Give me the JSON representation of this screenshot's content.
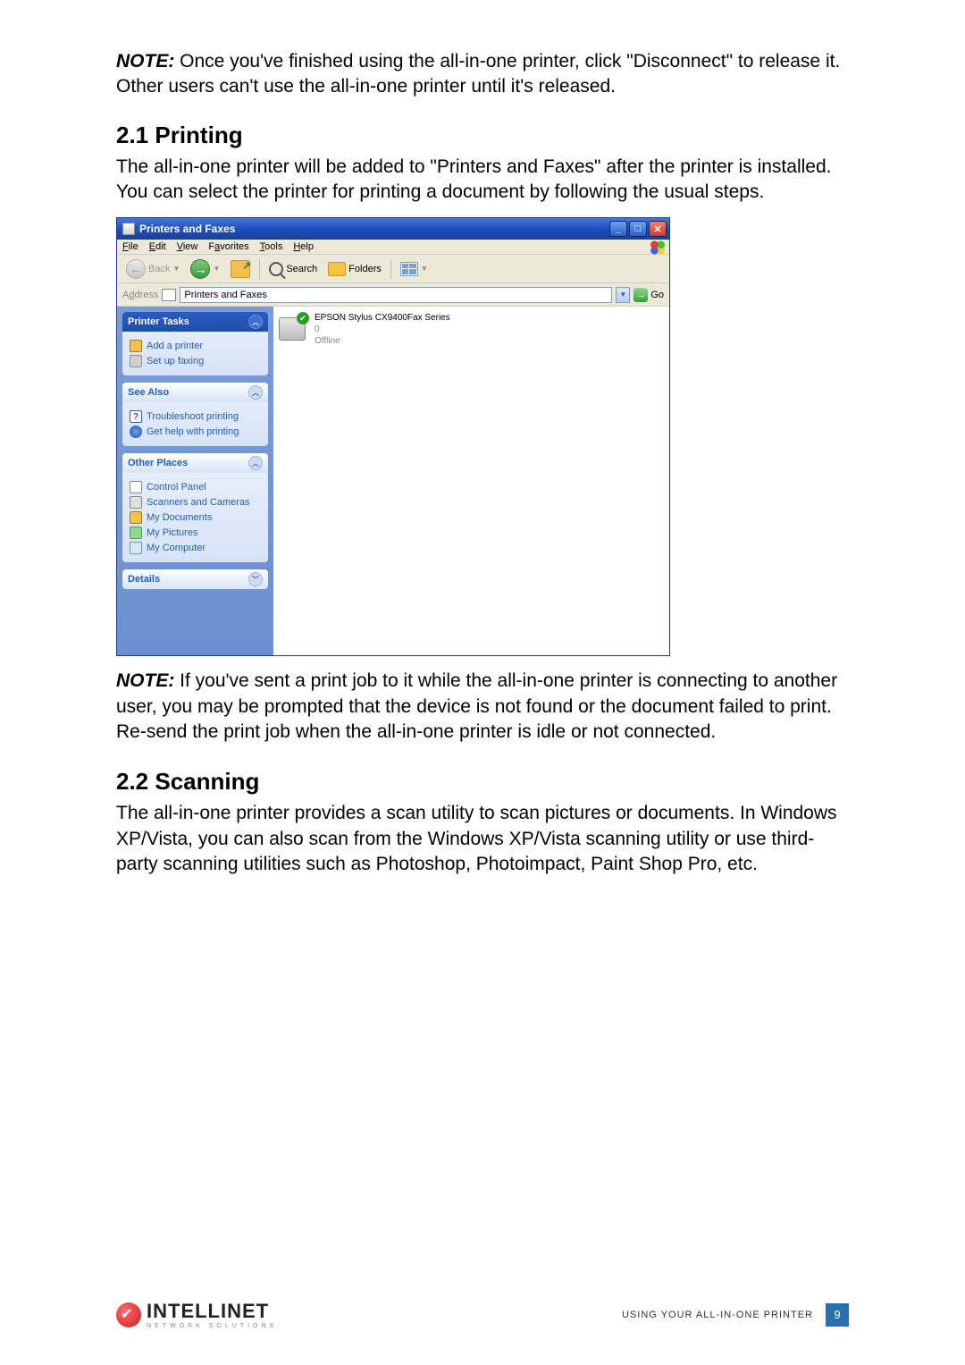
{
  "intro": {
    "note_prefix": "NOTE:",
    "text": " Once you've finished using the all-in-one printer, click \"Disconnect\" to release it. Other users can't use the all-in-one printer until it's released."
  },
  "section1": {
    "heading": "2.1  Printing",
    "body": "The all-in-one printer will be added to \"Printers and Faxes\" after the printer is installed. You can select the printer for printing a document by following the usual steps.",
    "note_prefix": "NOTE:",
    "note_text": " If you've sent a print job to it while the all-in-one printer is connecting to another user, you may be prompted that the device is not found or the document failed to print. Re-send the print job when the all-in-one printer is idle or not connected."
  },
  "section2": {
    "heading": "2.2  Scanning",
    "body": "The all-in-one printer provides a scan utility to scan pictures or documents. In Windows XP/Vista, you can also scan from the Windows XP/Vista scanning utility or use third-party scanning utilities such as Photoshop, Photoimpact, Paint Shop Pro, etc."
  },
  "window": {
    "title": "Printers and Faxes",
    "menus": {
      "file": "File",
      "edit": "Edit",
      "view": "View",
      "favorites": "Favorites",
      "tools": "Tools",
      "help": "Help"
    },
    "toolbar": {
      "back": "Back",
      "search": "Search",
      "folders": "Folders"
    },
    "address": {
      "label": "Address",
      "value": "Printers and Faxes",
      "go": "Go"
    },
    "panels": {
      "tasks": {
        "title": "Printer Tasks",
        "items": [
          "Add a printer",
          "Set up faxing"
        ]
      },
      "seealso": {
        "title": "See Also",
        "items": [
          "Troubleshoot printing",
          "Get help with printing"
        ]
      },
      "places": {
        "title": "Other Places",
        "items": [
          "Control Panel",
          "Scanners and Cameras",
          "My Documents",
          "My Pictures",
          "My Computer"
        ]
      },
      "details": {
        "title": "Details"
      }
    },
    "printer": {
      "name": "EPSON Stylus CX9400Fax Series",
      "count": "0",
      "status": "Offline"
    }
  },
  "footer": {
    "brand": "INTELLINET",
    "tagline": "NETWORK SOLUTIONS",
    "label": "USING YOUR ALL-IN-ONE PRINTER",
    "page": "9"
  }
}
